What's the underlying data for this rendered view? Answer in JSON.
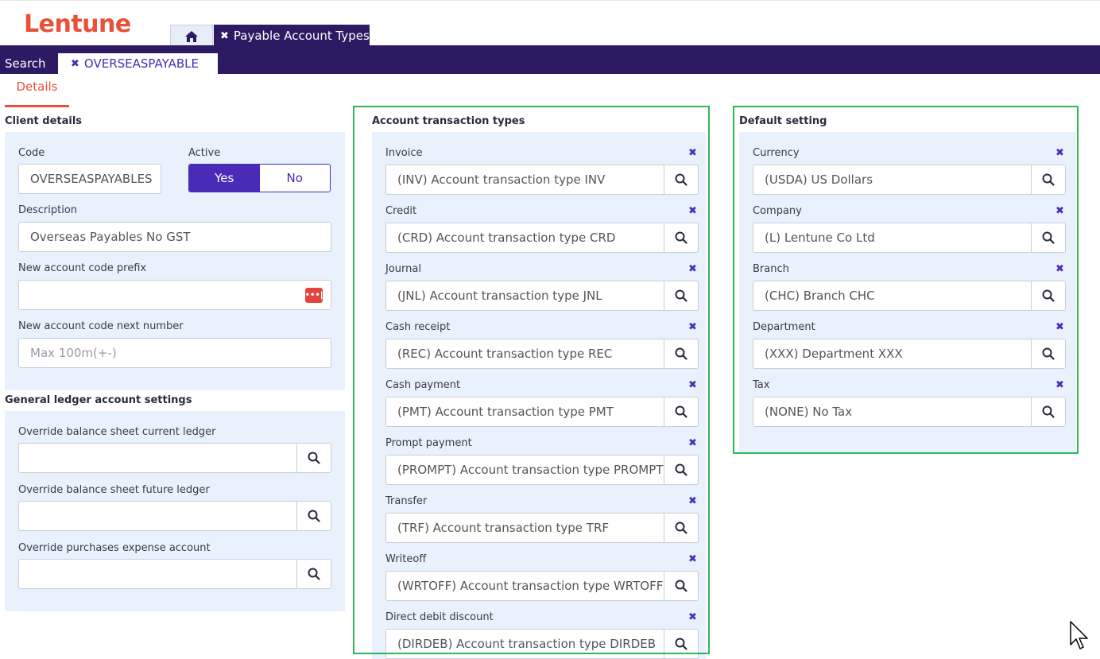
{
  "brand": {
    "logo": "Lentune"
  },
  "tabs": {
    "app_tab": "Payable Account Types"
  },
  "nav": {
    "search": "Search",
    "record_tab": "OVERSEASPAYABLE"
  },
  "details_tab": "Details",
  "client_details": {
    "title": "Client details",
    "code_label": "Code",
    "code_value": "OVERSEASPAYABLES",
    "active_label": "Active",
    "yes": "Yes",
    "no": "No",
    "description_label": "Description",
    "description_value": "Overseas Payables No GST",
    "prefix_label": "New account code prefix",
    "prefix_value": "",
    "ellipsis": "•••|",
    "next_number_label": "New account code next number",
    "next_number_placeholder": "Max 100m(+-)"
  },
  "gl_settings": {
    "title": "General ledger account settings",
    "fields": [
      {
        "label": "Override balance sheet current ledger",
        "value": ""
      },
      {
        "label": "Override balance sheet future ledger",
        "value": ""
      },
      {
        "label": "Override purchases expense account",
        "value": ""
      }
    ]
  },
  "account_transaction_types": {
    "title": "Account transaction types",
    "fields": [
      {
        "label": "Invoice",
        "value": "(INV) Account transaction type INV"
      },
      {
        "label": "Credit",
        "value": "(CRD) Account transaction type CRD"
      },
      {
        "label": "Journal",
        "value": "(JNL) Account transaction type JNL"
      },
      {
        "label": "Cash receipt",
        "value": "(REC) Account transaction type REC"
      },
      {
        "label": "Cash payment",
        "value": "(PMT) Account transaction type PMT"
      },
      {
        "label": "Prompt payment",
        "value": "(PROMPT) Account transaction type PROMPT"
      },
      {
        "label": "Transfer",
        "value": "(TRF) Account transaction type TRF"
      },
      {
        "label": "Writeoff",
        "value": "(WRTOFF) Account transaction type WRTOFF"
      },
      {
        "label": "Direct debit discount",
        "value": "(DIRDEB) Account transaction type DIRDEB"
      }
    ]
  },
  "default_setting": {
    "title": "Default setting",
    "fields": [
      {
        "label": "Currency",
        "value": "(USDA) US Dollars"
      },
      {
        "label": "Company",
        "value": "(L) Lentune Co Ltd"
      },
      {
        "label": "Branch",
        "value": "(CHC) Branch CHC"
      },
      {
        "label": "Department",
        "value": "(XXX) Department XXX"
      },
      {
        "label": "Tax",
        "value": "(NONE) No Tax"
      }
    ]
  },
  "icons": {
    "clear": "✖",
    "search": "search-icon",
    "home": "home-icon"
  },
  "colors": {
    "brand": "#e8503a",
    "nav": "#2d1a63",
    "accent": "#4a2bb8",
    "panel": "#e8f1fc",
    "highlight": "#2fb85a"
  }
}
